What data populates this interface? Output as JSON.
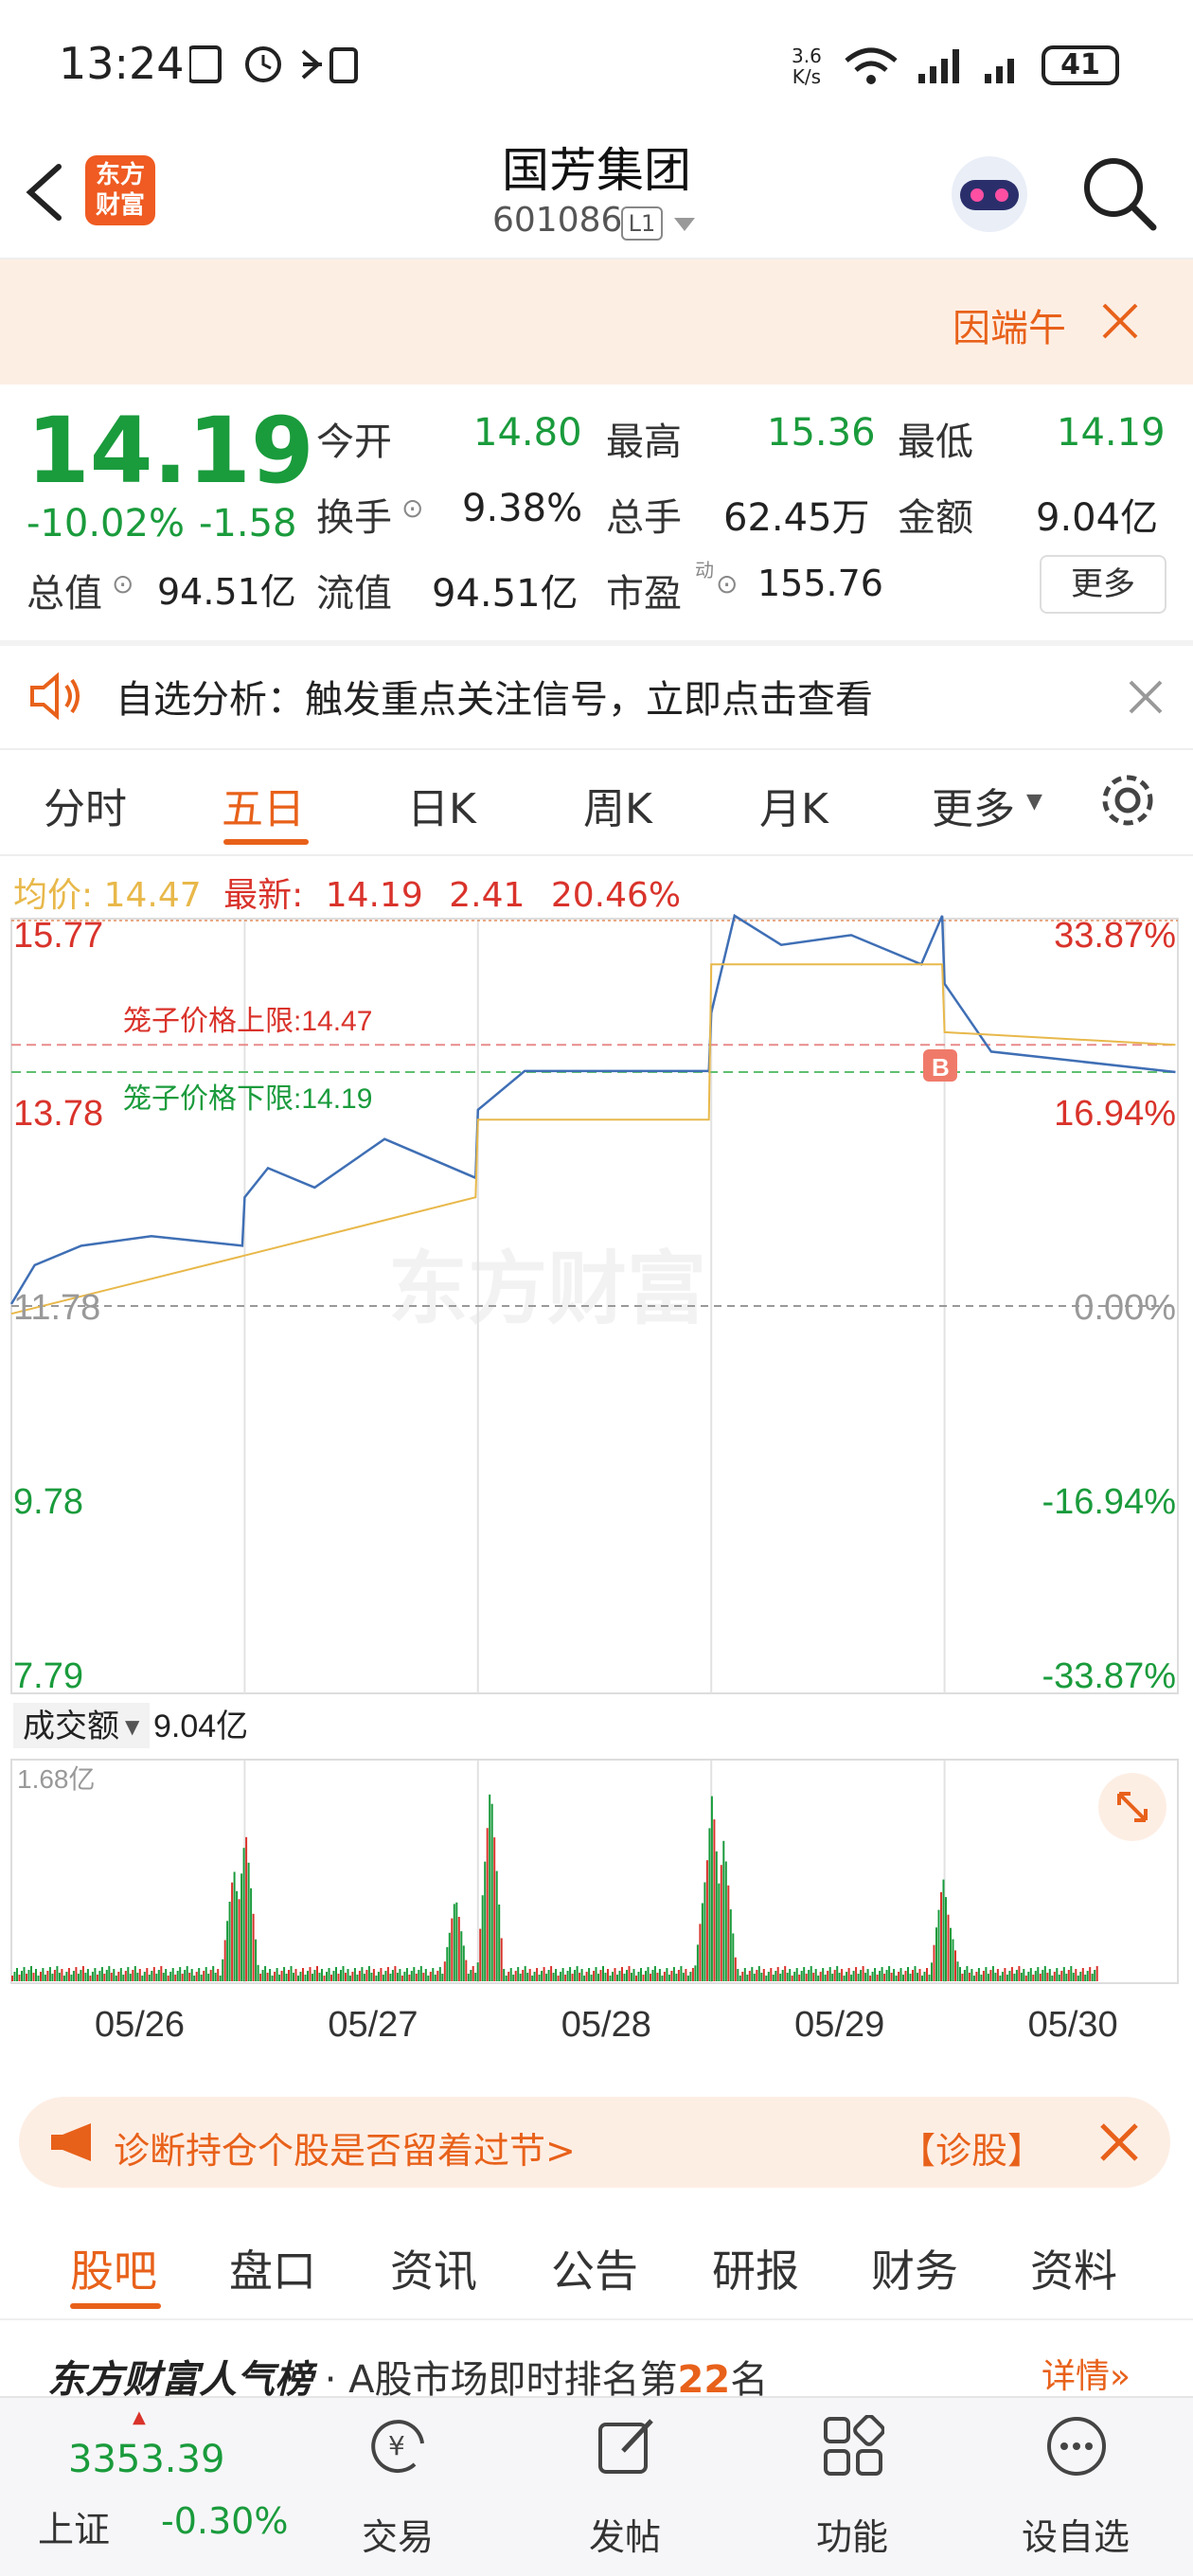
{
  "status_bar": {
    "time": "13:24",
    "net_speed_top": "3.6",
    "net_speed_unit": "K/s",
    "battery": "41"
  },
  "header": {
    "stock_name": "国芳集团",
    "stock_code": "601086",
    "level": "L1",
    "logo_line1": "东方",
    "logo_line2": "财富"
  },
  "banner": {
    "text": "因端午"
  },
  "quote": {
    "price": "14.19",
    "change_pct": "-10.02%",
    "change": "-1.58",
    "fields": [
      {
        "label": "今开",
        "value": "14.80"
      },
      {
        "label": "最高",
        "value": "15.36"
      },
      {
        "label": "最低",
        "value": "14.19"
      },
      {
        "label": "换手",
        "value": "9.38%"
      },
      {
        "label": "总手",
        "value": "62.45万"
      },
      {
        "label": "金额",
        "value": "9.04亿"
      },
      {
        "label": "总值",
        "value": "94.51亿"
      },
      {
        "label": "流值",
        "value": "94.51亿"
      },
      {
        "label": "市盈",
        "value": "155.76"
      }
    ],
    "pe_superscript": "动",
    "more_label": "更多"
  },
  "notice": {
    "text": "自选分析：触发重点关注信号，立即点击查看"
  },
  "chart_tabs": [
    "分时",
    "五日",
    "日K",
    "周K",
    "月K",
    "更多"
  ],
  "chart_info": {
    "avg_label": "均价:",
    "avg_value": "14.47",
    "latest_label": "最新:",
    "latest_value": "14.19",
    "change": "2.41",
    "change_pct": "20.46%"
  },
  "chart_data": {
    "type": "line",
    "title": "",
    "x_labels": [
      "05/26",
      "05/27",
      "05/28",
      "05/29",
      "05/30"
    ],
    "y_left_ticks": [
      "15.77",
      "13.78",
      "11.78",
      "9.78",
      "7.79"
    ],
    "y_right_ticks": [
      "33.87%",
      "16.94%",
      "0.00%",
      "-16.94%",
      "-33.87%"
    ],
    "ylim": [
      7.79,
      15.77
    ],
    "prev_close": 11.78,
    "series": [
      {
        "color": "#3f6fb5",
        "x": [
          0,
          0.1,
          0.3,
          0.6,
          0.99,
          1.0,
          1.1,
          1.3,
          1.6,
          1.99,
          2.0,
          2.2,
          2.99,
          3.0,
          3.1,
          3.3,
          3.6,
          3.9,
          3.99,
          4.0,
          4.2,
          4.99
        ],
        "y": [
          11.8,
          12.2,
          12.4,
          12.5,
          12.4,
          12.9,
          13.2,
          13.0,
          13.5,
          13.1,
          13.8,
          14.2,
          14.2,
          14.8,
          15.8,
          15.5,
          15.6,
          15.3,
          15.8,
          15.1,
          14.4,
          14.19
        ]
      },
      {
        "color": "#e8b84a",
        "x": [
          0,
          1.0,
          1.99,
          2.0,
          2.99,
          3.0,
          3.99,
          4.0,
          4.99
        ],
        "y": [
          11.7,
          12.3,
          12.9,
          13.7,
          13.7,
          15.3,
          15.3,
          14.6,
          14.47
        ]
      }
    ],
    "limits": {
      "upper_label": "笼子价格上限:",
      "upper_value": "14.47",
      "lower_label": "笼子价格下限:",
      "lower_value": "14.19"
    },
    "volume_label": "成交额",
    "volume_value": "9.04亿",
    "volume_max_label": "1.68亿",
    "marker_label": "B",
    "watermark": "东方财富"
  },
  "promo": {
    "text": "诊断持仓个股是否留着过节>",
    "tag": "【诊股】"
  },
  "bottom_tabs": [
    "股吧",
    "盘口",
    "资讯",
    "公告",
    "研报",
    "财务",
    "资料"
  ],
  "rank": {
    "title": "东方财富人气榜",
    "text": "· A股市场即时排名第",
    "rank_value": "22",
    "suffix": "名",
    "link": "详情"
  },
  "bottom_nav": {
    "index_value": "3353.39",
    "index_name": "上证",
    "index_change": "-0.30%",
    "items": [
      {
        "label": "交易",
        "icon": "yuan-refresh-icon"
      },
      {
        "label": "发帖",
        "icon": "edit-icon"
      },
      {
        "label": "功能",
        "icon": "grid-icon"
      },
      {
        "label": "设自选",
        "icon": "more-dots-icon"
      }
    ]
  }
}
